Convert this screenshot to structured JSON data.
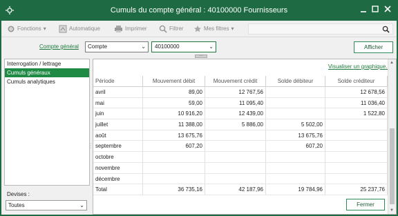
{
  "window": {
    "title": "Cumuls du compte général : 40100000 Fournisseurs",
    "colors": {
      "titlebar": "#1e6b43",
      "accent": "#1e8a44",
      "link": "#1e7a3c"
    }
  },
  "toolbar": {
    "fonctions": "Fonctions",
    "automatique": "Automatique",
    "imprimer": "Imprimer",
    "filtrer": "Filtrer",
    "mes_filtres": "Mes filtres",
    "search_placeholder": ""
  },
  "filter": {
    "label": "Compte général",
    "type_value": "Compte",
    "account_value": "40100000",
    "afficher": "Afficher"
  },
  "sidebar": {
    "items": [
      {
        "label": "Interrogation / lettrage",
        "active": false
      },
      {
        "label": "Cumuls généraux",
        "active": true
      },
      {
        "label": "Cumuls analytiques",
        "active": false
      }
    ],
    "devises_label": "Devises :",
    "devises_value": "Toutes"
  },
  "main": {
    "visualiser_link": "Visualiser un graphique...",
    "columns": [
      "Période",
      "Mouvement débit",
      "Mouvement crédit",
      "Solde débiteur",
      "Solde créditeur"
    ],
    "rows": [
      [
        "avril",
        "89,00",
        "12 767,56",
        "",
        "12 678,56"
      ],
      [
        "mai",
        "59,00",
        "11 095,40",
        "",
        "11 036,40"
      ],
      [
        "juin",
        "10 916,20",
        "12 439,00",
        "",
        "1 522,80"
      ],
      [
        "juillet",
        "11 388,00",
        "5 886,00",
        "5 502,00",
        ""
      ],
      [
        "août",
        "13 675,76",
        "",
        "13 675,76",
        ""
      ],
      [
        "septembre",
        "607,20",
        "",
        "607,20",
        ""
      ],
      [
        "octobre",
        "",
        "",
        "",
        ""
      ],
      [
        "novembre",
        "",
        "",
        "",
        ""
      ],
      [
        "décembre",
        "",
        "",
        "",
        ""
      ],
      [
        "Total",
        "36 735,16",
        "42 187,96",
        "19 784,96",
        "25 237,76"
      ]
    ]
  },
  "footer": {
    "fermer": "Fermer"
  }
}
